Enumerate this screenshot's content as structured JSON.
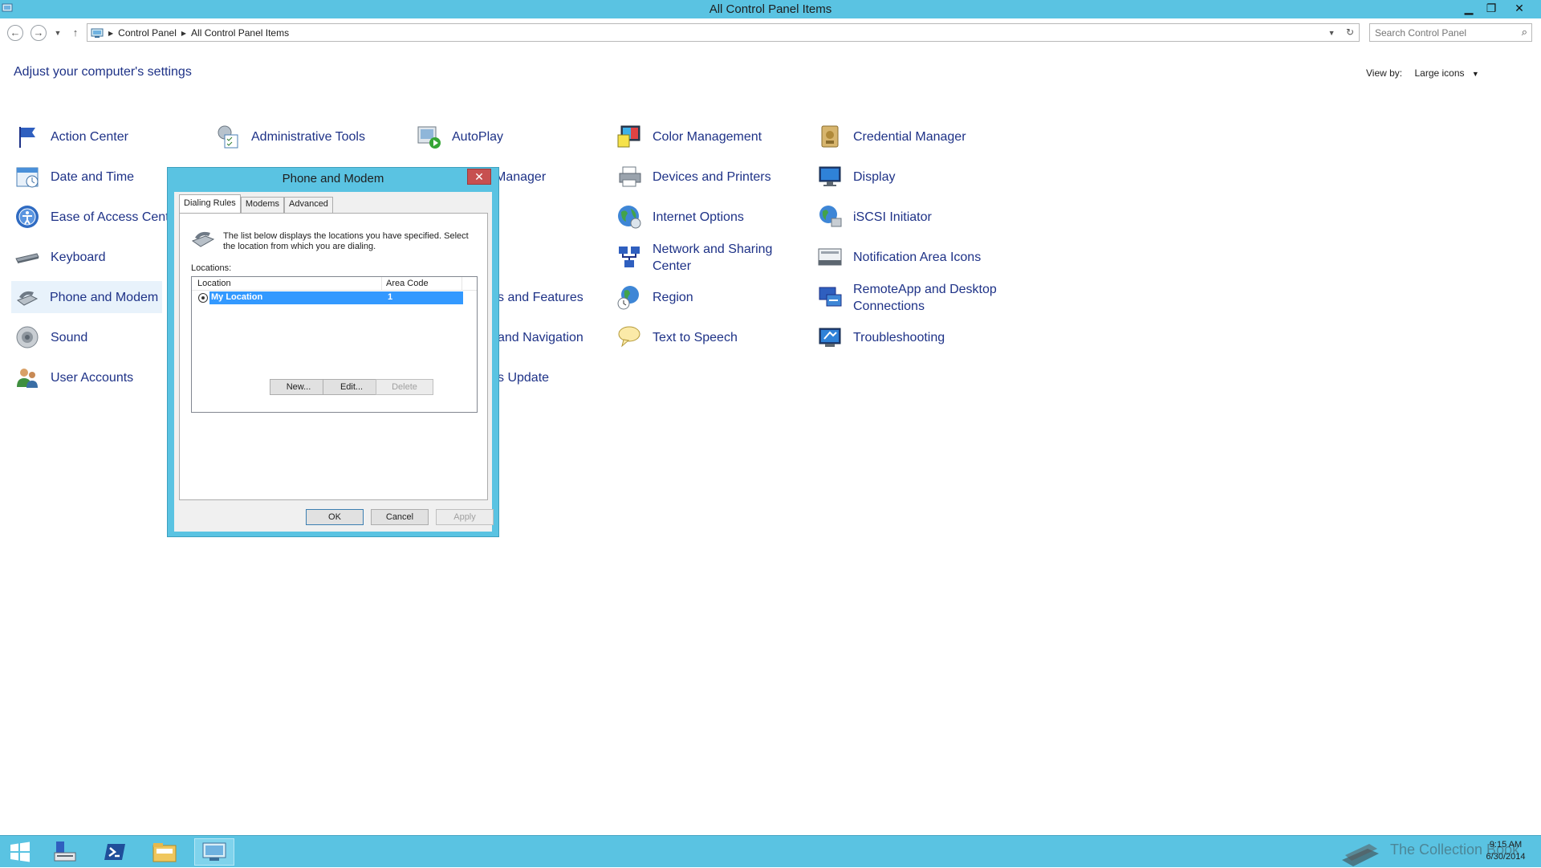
{
  "window": {
    "title": "All Control Panel Items",
    "minimize": "▁",
    "restore": "❐",
    "close": "✕"
  },
  "nav": {
    "breadcrumbs": [
      "Control Panel",
      "All Control Panel Items"
    ],
    "search_placeholder": "Search Control Panel"
  },
  "main": {
    "heading": "Adjust your computer's settings",
    "view_by_label": "View by:",
    "view_by_value": "Large icons"
  },
  "items": [
    {
      "label": "Action Center",
      "icon": "flag-icon"
    },
    {
      "label": "Administrative Tools",
      "icon": "admin-tools-icon"
    },
    {
      "label": "AutoPlay",
      "icon": "autoplay-icon"
    },
    {
      "label": "Color Management",
      "icon": "color-management-icon"
    },
    {
      "label": "Credential Manager",
      "icon": "credential-icon"
    },
    {
      "label": "Date and Time",
      "icon": "calendar-icon"
    },
    {
      "label": "Manager",
      "icon": "device-manager-icon"
    },
    {
      "label": "Devices and Printers",
      "icon": "printer-icon"
    },
    {
      "label": "Display",
      "icon": "display-icon"
    },
    {
      "label": "Ease of Access Center",
      "icon": "ease-of-access-icon"
    },
    {
      "label": "Internet Options",
      "icon": "globe-icon"
    },
    {
      "label": "iSCSI Initiator",
      "icon": "iscsi-icon"
    },
    {
      "label": "Keyboard",
      "icon": "keyboard-icon"
    },
    {
      "label": "Network and Sharing Center",
      "icon": "network-icon"
    },
    {
      "label": "Notification Area Icons",
      "icon": "notification-icon"
    },
    {
      "label": "Phone and Modem",
      "icon": "phone-modem-icon"
    },
    {
      "label": "s and Features",
      "icon": "programs-icon"
    },
    {
      "label": "Region",
      "icon": "region-icon"
    },
    {
      "label": "RemoteApp and Desktop Connections",
      "icon": "remoteapp-icon"
    },
    {
      "label": "Sound",
      "icon": "speaker-icon"
    },
    {
      "label": "and Navigation",
      "icon": "taskbar-icon"
    },
    {
      "label": "Text to Speech",
      "icon": "speech-icon"
    },
    {
      "label": "Troubleshooting",
      "icon": "troubleshooting-icon"
    },
    {
      "label": "User Accounts",
      "icon": "users-icon"
    },
    {
      "label": "s Update",
      "icon": "windows-update-icon"
    }
  ],
  "dialog": {
    "title": "Phone and Modem",
    "close": "✕",
    "tabs": [
      "Dialing Rules",
      "Modems",
      "Advanced"
    ],
    "description": "The list below displays the locations you have specified. Select the location from which you are dialing.",
    "locations_label": "Locations:",
    "columns": [
      "Location",
      "Area Code"
    ],
    "rows": [
      {
        "location": "My Location",
        "area_code": "1"
      }
    ],
    "new_label": "New...",
    "edit_label": "Edit...",
    "delete_label": "Delete",
    "ok_label": "OK",
    "cancel_label": "Cancel",
    "apply_label": "Apply"
  },
  "taskbar": {
    "time": "9:15 AM",
    "date": "6/30/2014",
    "watermark": "The Collection Book"
  },
  "colors": {
    "accent": "#5ac3e2",
    "link": "#1e3287",
    "selection": "#3399ff",
    "close": "#c75050"
  }
}
